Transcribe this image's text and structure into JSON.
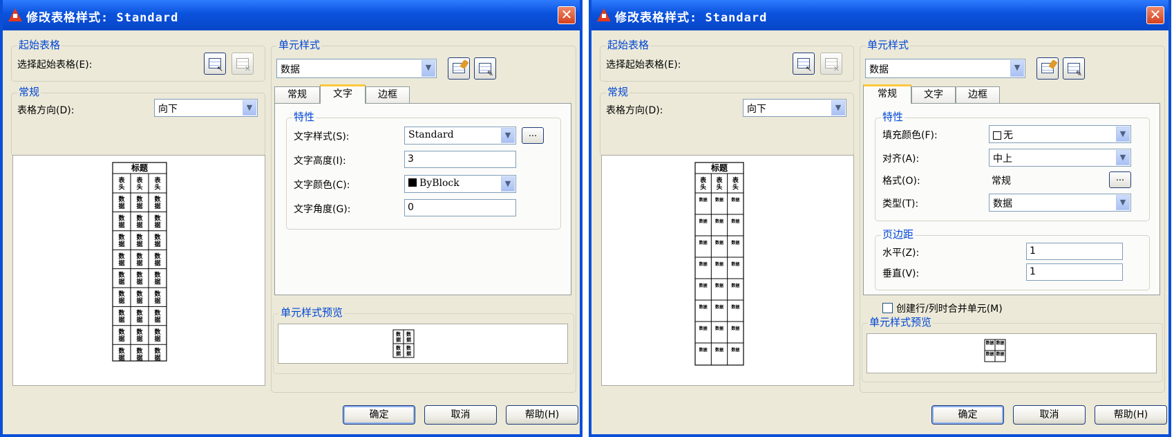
{
  "dialogs": [
    {
      "title": "修改表格样式: Standard",
      "starting_table": {
        "group": "起始表格",
        "label": "选择起始表格(E):"
      },
      "general": {
        "group": "常规",
        "direction_label": "表格方向(D):",
        "direction_value": "向下"
      },
      "cell_style": {
        "group": "单元样式",
        "value": "数据"
      },
      "tabs": [
        "常规",
        "文字",
        "边框"
      ],
      "active_tab": 1,
      "props": {
        "group": "特性",
        "text_style_label": "文字样式(S):",
        "text_style_value": "Standard",
        "browse_label": "...",
        "text_height_label": "文字高度(I):",
        "text_height_value": "3",
        "text_color_label": "文字颜色(C):",
        "text_color_value": "ByBlock",
        "text_angle_label": "文字角度(G):",
        "text_angle_value": "0"
      },
      "cell_preview": {
        "group": "单元样式预览"
      },
      "table_preview": {
        "title": "标题",
        "header": [
          "表头",
          "表头",
          "表头"
        ],
        "data": "数据"
      },
      "buttons": {
        "ok": "确定",
        "cancel": "取消",
        "help": "帮助(H)"
      }
    },
    {
      "title": "修改表格样式: Standard",
      "starting_table": {
        "group": "起始表格",
        "label": "选择起始表格(E):"
      },
      "general": {
        "group": "常规",
        "direction_label": "表格方向(D):",
        "direction_value": "向下"
      },
      "cell_style": {
        "group": "单元样式",
        "value": "数据"
      },
      "tabs": [
        "常规",
        "文字",
        "边框"
      ],
      "active_tab": 0,
      "props": {
        "group": "特性",
        "fill_label": "填充颜色(F):",
        "fill_value": "无",
        "align_label": "对齐(A):",
        "align_value": "中上",
        "format_label": "格式(O):",
        "format_value": "常规",
        "browse_label": "...",
        "type_label": "类型(T):",
        "type_value": "数据"
      },
      "margins": {
        "group": "页边距",
        "h_label": "水平(Z):",
        "h_value": "1",
        "v_label": "垂直(V):",
        "v_value": "1"
      },
      "merge_label": "创建行/列时合并单元(M)",
      "cell_preview": {
        "group": "单元样式预览"
      },
      "table_preview": {
        "title": "标题",
        "header": [
          "表头",
          "表头",
          "表头"
        ],
        "data": "数据"
      },
      "buttons": {
        "ok": "确定",
        "cancel": "取消",
        "help": "帮助(H)"
      }
    }
  ]
}
